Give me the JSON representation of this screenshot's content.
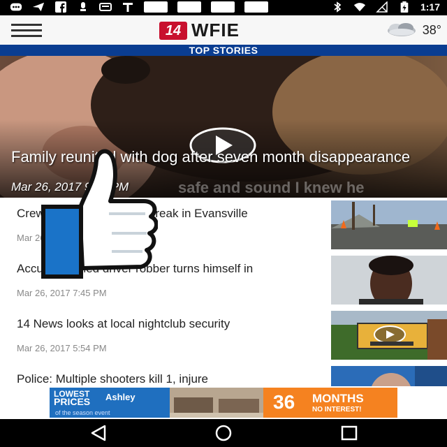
{
  "status_bar": {
    "time": "1:17",
    "icons": [
      "messaging-icon",
      "send-icon",
      "facebook-icon",
      "alert-icon",
      "chat-icon",
      "t-icon",
      "app-icon",
      "app-icon",
      "app-icon",
      "app-icon",
      "bluetooth-icon",
      "wifi-icon",
      "no-signal-icon",
      "battery-icon"
    ]
  },
  "app_bar": {
    "logo_number": "14",
    "logo_text": "WFIE",
    "temperature": "38°"
  },
  "section_header": "TOP STORIES",
  "hero": {
    "title": "Family reunited with dog after seven month disappearance",
    "date": "Mar 26, 2017 9:06 PM",
    "caption_overlay": "safe and sound I knew he"
  },
  "stories": [
    {
      "title": "Crews repair water main break in Evansville",
      "date": "Mar 26, 2017"
    },
    {
      "title": "Accused armed driver robber turns himself in",
      "date": "Mar 26, 2017 7:45 PM"
    },
    {
      "title": "14 News looks at local nightclub security",
      "date": "Mar 26, 2017 5:54 PM"
    },
    {
      "title": "Police: Multiple shooters kill 1, injure",
      "date": ""
    }
  ],
  "ad": {
    "left_line1": "LOWEST",
    "left_line2": "PRICES",
    "brand": "Ashley",
    "subline": "of the season event",
    "number": "36",
    "months": "MONTHS",
    "interest": "NO INTEREST!"
  },
  "colors": {
    "accent_blue": "#0a3d91",
    "brand_red": "#c8102e",
    "ad_orange": "#f58220",
    "thumbs_blue": "#1a73c8"
  }
}
